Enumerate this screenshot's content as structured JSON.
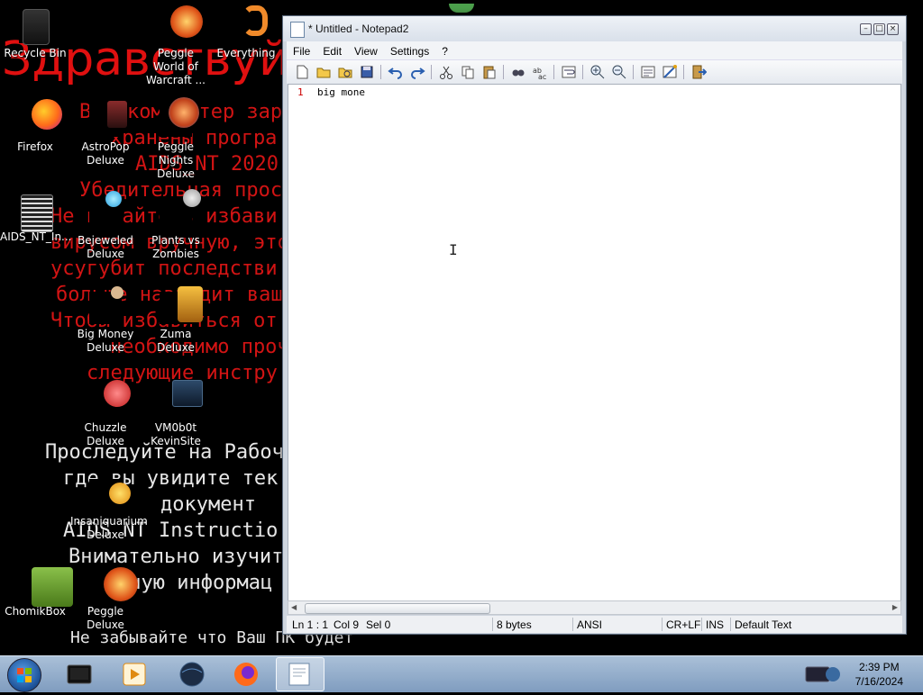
{
  "wallpaper": {
    "big_text": "Здравствуй",
    "red_lines": [
      "Ваш компьютер зар",
      "хранены програ",
      "AIDS_NT 2020",
      "Убедительная прос",
      "Не пытайтесь избави",
      "вирусом вручную, это",
      "усугубит последстви",
      "больше навредит ваш",
      "Чтобы избавиться от",
      "необходимо прочи",
      "следующие инстру"
    ],
    "white_lines": [
      "Проследуйте на Рабоч",
      "где вы увидите тек",
      "документ",
      "AIDS NT Instructio",
      "Внимательно изучит",
      "нную информац",
      "Не забывайте что Ваш ПК будет"
    ]
  },
  "desktop_icons": [
    {
      "label": "Recycle Bin"
    },
    {
      "label": "Peggle World of Warcraft ..."
    },
    {
      "label": "Everything"
    },
    {
      "label": "Firefox"
    },
    {
      "label": "AstroPop Deluxe"
    },
    {
      "label": "Peggle Nights Deluxe"
    },
    {
      "label": "AIDS_NT_In..."
    },
    {
      "label": "Bejeweled Deluxe"
    },
    {
      "label": "Plants vs Zombies"
    },
    {
      "label": "Big Money Deluxe"
    },
    {
      "label": "Zuma Deluxe"
    },
    {
      "label": "Chuzzle Deluxe"
    },
    {
      "label": "VM0b0t KevinSite"
    },
    {
      "label": "Insaniquarium Deluxe"
    },
    {
      "label": "ChomikBox"
    },
    {
      "label": "Peggle Deluxe"
    }
  ],
  "notepad": {
    "title": "* Untitled - Notepad2",
    "menu": [
      "File",
      "Edit",
      "View",
      "Settings",
      "?"
    ],
    "line_number": "1",
    "content": "big mone",
    "status": {
      "position": "Ln 1 : 1",
      "col": "Col 9",
      "sel": "Sel 0",
      "size": "8 bytes",
      "encoding": "ANSI",
      "line_endings": "CR+LF",
      "ins": "INS",
      "scheme": "Default Text"
    }
  },
  "taskbar": {
    "time": "2:39 PM",
    "date": "7/16/2024"
  },
  "colors": {
    "wallpaper_red": "#d21414",
    "taskbar": "#8fa9c8",
    "line_number": "#cc0000"
  }
}
